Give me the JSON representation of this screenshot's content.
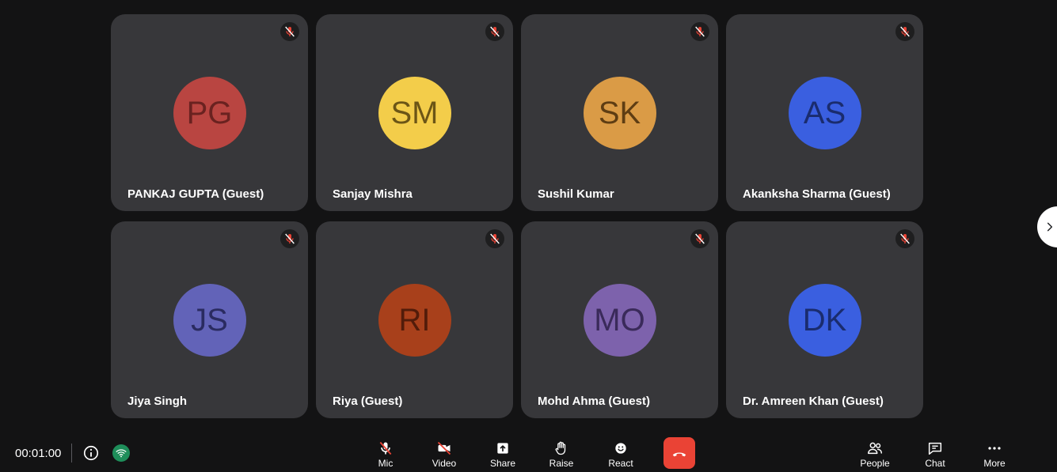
{
  "participants": [
    {
      "initials": "PG",
      "name": "PANKAJ GUPTA (Guest)",
      "color": "#b94541",
      "text_color": "#6a2220"
    },
    {
      "initials": "SM",
      "name": "Sanjay Mishra",
      "color": "#f3cd4a",
      "text_color": "#6b5516"
    },
    {
      "initials": "SK",
      "name": "Sushil Kumar",
      "color": "#da9b46",
      "text_color": "#5e3d13"
    },
    {
      "initials": "AS",
      "name": "Akanksha Sharma (Guest)",
      "color": "#3a5fe0",
      "text_color": "#1a2c6e"
    },
    {
      "initials": "JS",
      "name": "Jiya Singh",
      "color": "#6263b8",
      "text_color": "#2a2b60"
    },
    {
      "initials": "RI",
      "name": "Riya (Guest)",
      "color": "#a8401b",
      "text_color": "#521c0a"
    },
    {
      "initials": "MO",
      "name": "Mohd Ahma (Guest)",
      "color": "#7d62ac",
      "text_color": "#3a2a5a"
    },
    {
      "initials": "DK",
      "name": "Dr. Amreen Khan (Guest)",
      "color": "#3a5fe0",
      "text_color": "#1a2c6e"
    }
  ],
  "status": {
    "timer": "00:01:00"
  },
  "controls": {
    "mic": "Mic",
    "video": "Video",
    "share": "Share",
    "raise": "Raise",
    "react": "React",
    "people": "People",
    "chat": "Chat",
    "more": "More"
  },
  "colors": {
    "background": "#131314",
    "tile": "#37373a",
    "end_call": "#ea4335",
    "mute_icon": "#ea4335",
    "network_good": "#1e8e5a"
  }
}
